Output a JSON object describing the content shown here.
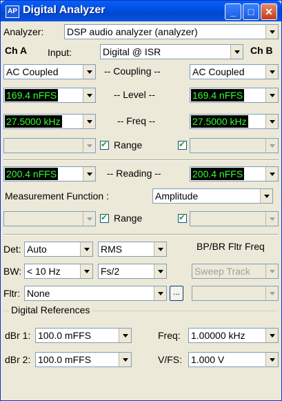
{
  "window": {
    "title": "Digital Analyzer",
    "icon_text": "AP"
  },
  "analyzer": {
    "label": "Analyzer:",
    "value": "DSP audio analyzer (analyzer)"
  },
  "channels": {
    "a": "Ch A",
    "b": "Ch B",
    "input_label": "Input:",
    "input_value": "Digital @ ISR"
  },
  "coupling": {
    "label": "-- Coupling --",
    "a": "AC Coupled",
    "b": "AC Coupled"
  },
  "level": {
    "label": "-- Level --",
    "a": "169.4  nFFS",
    "b": "169.4  nFFS"
  },
  "freq": {
    "label": "-- Freq --",
    "a": "27.5000 kHz",
    "b": "27.5000 kHz"
  },
  "range1": {
    "label": "Range"
  },
  "reading": {
    "label": "-- Reading --",
    "a": "200.4  nFFS",
    "b": "200.4  nFFS"
  },
  "measurement": {
    "label": "Measurement Function :",
    "value": "Amplitude"
  },
  "range2": {
    "label": "Range"
  },
  "det": {
    "label": "Det:",
    "value": "Auto",
    "mode": "RMS"
  },
  "bp_br": {
    "label": "BP/BR Fltr Freq",
    "value": "Sweep Track"
  },
  "bw": {
    "label": "BW:",
    "value": "< 10 Hz",
    "fs": "Fs/2"
  },
  "fltr": {
    "label": "Fltr:",
    "value": "None",
    "more": "..."
  },
  "refs": {
    "title": "Digital References",
    "dbr1_label": "dBr 1:",
    "dbr1_value": "100.0  mFFS",
    "dbr2_label": "dBr 2:",
    "dbr2_value": "100.0  mFFS",
    "freq_label": "Freq:",
    "freq_value": "1.00000 kHz",
    "vfs_label": "V/FS:",
    "vfs_value": "1.000   V"
  }
}
